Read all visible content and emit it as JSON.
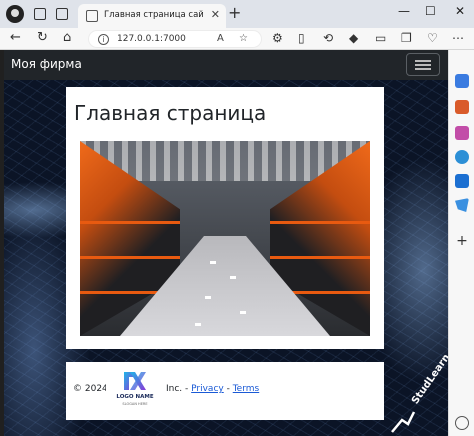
{
  "browser": {
    "tab_title": "Главная страница сайта -Мой Co",
    "tab_close": "✕",
    "new_tab": "+",
    "url": "127.0.0.1:7000",
    "window_controls": {
      "minimize": "—",
      "maximize": "☐",
      "close": "✕"
    }
  },
  "site": {
    "brand": "Моя фирма",
    "page_title": "Главная страница"
  },
  "footer": {
    "copyright": "© 2024",
    "logo": {
      "name": "LOGO NAME",
      "tagline": "SLOGAN HERE"
    },
    "company_suffix": "Inc. - ",
    "privacy": "Privacy",
    "separator": " - ",
    "terms": "Terms"
  },
  "watermark": "StudLearn"
}
